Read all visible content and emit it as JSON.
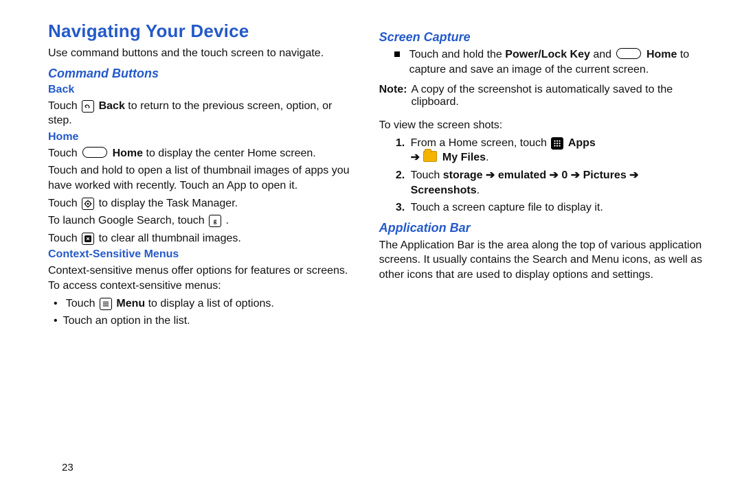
{
  "title": "Navigating Your Device",
  "pageNumber": "23",
  "left": {
    "intro": "Use command buttons and the touch screen to navigate.",
    "cmdButtons": "Command Buttons",
    "back": {
      "h": "Back",
      "p1a": "Touch ",
      "p1b": " Back",
      "p1c": " to return to the previous screen, option, or step."
    },
    "home": {
      "h": "Home",
      "p1a": "Touch ",
      "p1b": " Home",
      "p1c": " to display the center Home screen.",
      "p2": "Touch and hold to open a list of thumbnail images of apps you have worked with recently. Touch an App to open it.",
      "p3a": "Touch ",
      "p3b": " to display the Task Manager.",
      "p4a": "To launch Google Search, touch ",
      "p4b": " .",
      "p5a": "Touch ",
      "p5b": " to clear all thumbnail images."
    },
    "ctx": {
      "h": "Context-Sensitive Menus",
      "p1": "Context-sensitive menus offer options for features or screens. To access context-sensitive menus:",
      "b1a": "Touch ",
      "b1b": " Menu",
      "b1c": " to display a list of options.",
      "b2": "Touch an option in the list."
    }
  },
  "right": {
    "screenCap": {
      "h": "Screen Capture",
      "sq1a": "Touch and hold the ",
      "sq1b": "Power/Lock Key",
      "sq1c": " and ",
      "sq1d": " Home",
      "sq1e": " to capture and save an image of the current screen.",
      "noteLabel": "Note:",
      "noteBody": "A copy of the screenshot is automatically saved to the clipboard.",
      "view": "To view the screen shots:",
      "s1a": "From a Home screen, touch ",
      "s1b": " Apps",
      "s1arrow": "➔",
      "s1c": " My Files",
      "s1d": ".",
      "s2a": "Touch ",
      "s2b": "storage ➔ emulated ➔ 0 ➔ Pictures ➔ Screenshots",
      "s2c": ".",
      "s3": "Touch a screen capture file to display it."
    },
    "appBar": {
      "h": "Application Bar",
      "p": "The Application Bar is the area along the top of various application screens. It usually contains the Search and Menu icons, as well as other icons that are used to display options and settings."
    }
  }
}
